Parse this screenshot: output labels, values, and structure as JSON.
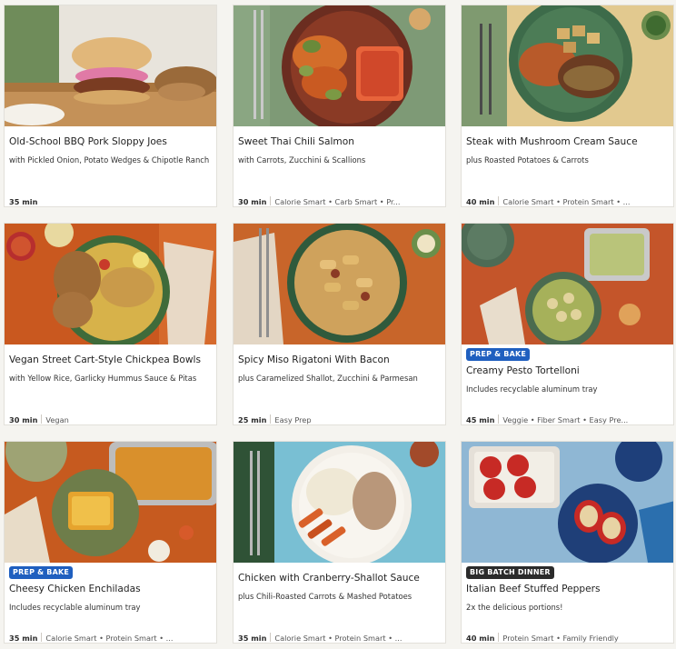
{
  "recipes": [
    {
      "title": "Old-School BBQ Pork Sloppy Joes",
      "subtitle": "with Pickled Onion, Potato Wedges & Chipotle Ranch",
      "time": "35 min",
      "tags": "",
      "badge": ""
    },
    {
      "title": "Sweet Thai Chili Salmon",
      "subtitle": "with Carrots, Zucchini & Scallions",
      "time": "30 min",
      "tags": "Calorie Smart • Carb Smart • Pr...",
      "badge": ""
    },
    {
      "title": "Steak with Mushroom Cream Sauce",
      "subtitle": "plus Roasted Potatoes & Carrots",
      "time": "40 min",
      "tags": "Calorie Smart • Protein Smart • ...",
      "badge": ""
    },
    {
      "title": "Vegan Street Cart-Style Chickpea Bowls",
      "subtitle": "with Yellow Rice, Garlicky Hummus Sauce & Pitas",
      "time": "30 min",
      "tags": "Vegan",
      "badge": ""
    },
    {
      "title": "Spicy Miso Rigatoni With Bacon",
      "subtitle": "plus Caramelized Shallot, Zucchini & Parmesan",
      "time": "25 min",
      "tags": "Easy Prep",
      "badge": ""
    },
    {
      "title": "Creamy Pesto Tortelloni",
      "subtitle": "Includes recyclable aluminum tray",
      "time": "45 min",
      "tags": "Veggie • Fiber Smart • Easy Pre...",
      "badge": "PREP & BAKE"
    },
    {
      "title": "Cheesy Chicken Enchiladas",
      "subtitle": "Includes recyclable aluminum tray",
      "time": "35 min",
      "tags": "Calorie Smart • Protein Smart • ...",
      "badge": "PREP & BAKE"
    },
    {
      "title": "Chicken with Cranberry-Shallot Sauce",
      "subtitle": "plus Chili-Roasted Carrots & Mashed Potatoes",
      "time": "35 min",
      "tags": "Calorie Smart • Protein Smart • ...",
      "badge": ""
    },
    {
      "title": "Italian Beef Stuffed Peppers",
      "subtitle": "2x the delicious portions!",
      "time": "40 min",
      "tags": "Protein Smart • Family Friendly",
      "badge": "BIG BATCH DINNER"
    }
  ],
  "colors": {
    "prep_bake_badge": "#1f5fbf",
    "big_batch_badge": "#2b2b2b"
  }
}
